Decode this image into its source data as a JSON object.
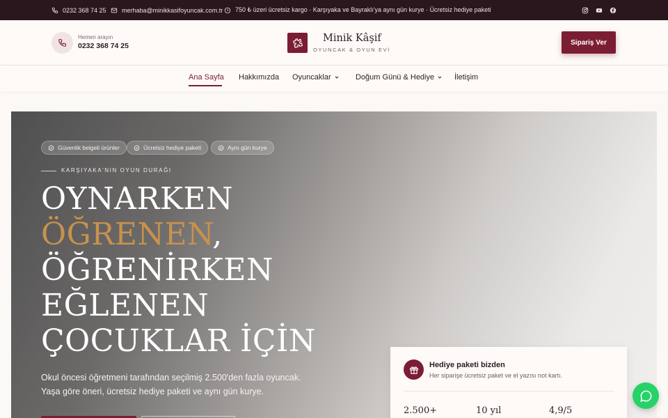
{
  "topbar": {
    "phone": "0232 368 74 25",
    "email": "merhaba@minikkasifoyuncak.com.tr",
    "notice": "750 ₺ üzeri ücretsiz kargo · Karşıyaka ve Bayraklı'ya aynı gün kurye · Ücretsiz hediye paketi",
    "social": [
      "instagram-icon",
      "youtube-icon",
      "facebook-icon"
    ]
  },
  "header": {
    "call_label": "Hemen arayın",
    "call_number": "0232 368 74 25",
    "logo_title": "Minik Kâşif",
    "logo_subtitle": "OYUNCAK & OYUN EVİ",
    "order_button": "Sipariş Ver"
  },
  "nav": {
    "items": [
      {
        "label": "Ana Sayfa",
        "active": true,
        "dropdown": false
      },
      {
        "label": "Hakkımızda",
        "active": false,
        "dropdown": false
      },
      {
        "label": "Oyuncaklar",
        "active": false,
        "dropdown": true
      },
      {
        "label": "Doğum Günü & Hediye",
        "active": false,
        "dropdown": true
      },
      {
        "label": "İletişim",
        "active": false,
        "dropdown": false
      }
    ]
  },
  "hero": {
    "badges": [
      "Güvenlik belgeli ürünler",
      "Ücretsiz hediye paketi",
      "Aynı gün kurye"
    ],
    "eyebrow": "KARŞIYAKA'NIN OYUN DURAĞI",
    "headline_line1": "OYNARKEN",
    "headline_gold": "ÖĞRENEN",
    "headline_comma": ",",
    "headline_line3": "ÖĞRENİRKEN",
    "headline_line4": "EĞLENEN",
    "headline_line5": "ÇOCUKLAR İÇİN",
    "description_line1": "Okul öncesi öğretmeni tarafından seçilmiş 2.500'den fazla oyuncak.",
    "description_line2": "Yaşa göre öneri, ücretsiz hediye paketi ve aynı gün kurye."
  },
  "gift_card": {
    "title": "Hediye paketi bizden",
    "subtitle": "Her siparişe ücretsiz paket ve el yazısı not kartı.",
    "stats": [
      "2.500+",
      "10 yıl",
      "4,9/5"
    ]
  },
  "colors": {
    "brand": "#7b1d33",
    "accent_gold": "#c8924d",
    "topbar_bg": "#2a171d",
    "whatsapp": "#25d366"
  }
}
